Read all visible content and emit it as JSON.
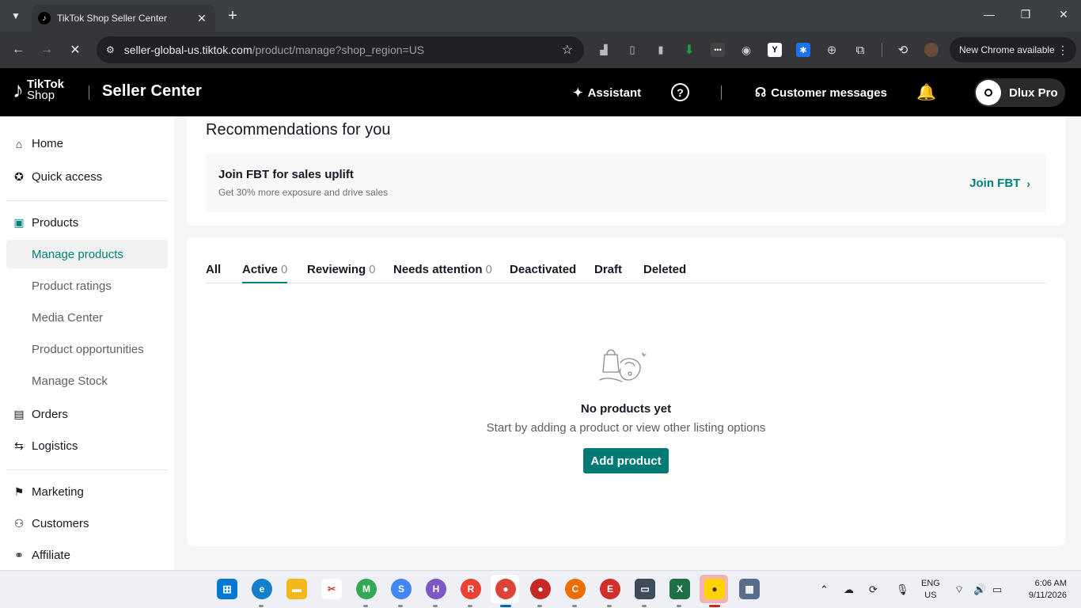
{
  "browser": {
    "tab_title": "TikTok Shop Seller Center",
    "url_host": "seller-global-us.tiktok.com",
    "url_path": "/product/manage?shop_region=US",
    "update_label": "New Chrome available"
  },
  "header": {
    "logo_line1": "TikTok",
    "logo_line2": "Shop",
    "title": "Seller Center",
    "assistant": "Assistant",
    "messages": "Customer messages",
    "user_name": "Dlux Pro"
  },
  "sidebar": {
    "home": "Home",
    "quick_access": "Quick access",
    "products": "Products",
    "manage_products": "Manage products",
    "product_ratings": "Product ratings",
    "media_center": "Media Center",
    "product_opportunities": "Product opportunities",
    "manage_stock": "Manage Stock",
    "orders": "Orders",
    "logistics": "Logistics",
    "marketing": "Marketing",
    "customers": "Customers",
    "affiliate": "Affiliate"
  },
  "recommendations": {
    "title": "Recommendations for you",
    "fbt_title": "Join FBT for sales uplift",
    "fbt_sub": "Get 30% more exposure and drive sales",
    "fbt_link": "Join FBT"
  },
  "product_tabs": {
    "all": "All",
    "active": "Active",
    "active_count": "0",
    "reviewing": "Reviewing",
    "reviewing_count": "0",
    "needs_attention": "Needs attention",
    "needs_attention_count": "0",
    "deactivated": "Deactivated",
    "draft": "Draft",
    "deleted": "Deleted"
  },
  "empty_state": {
    "title": "No products yet",
    "subtitle": "Start by adding a product or view other listing options",
    "button": "Add product"
  },
  "taskbar": {
    "lang1": "ENG",
    "lang2": "US",
    "time": "6:06 AM",
    "date": "9/11/2026"
  },
  "colors": {
    "accent": "#00807a",
    "header_bg": "#000000",
    "button_bg": "#007a74"
  }
}
